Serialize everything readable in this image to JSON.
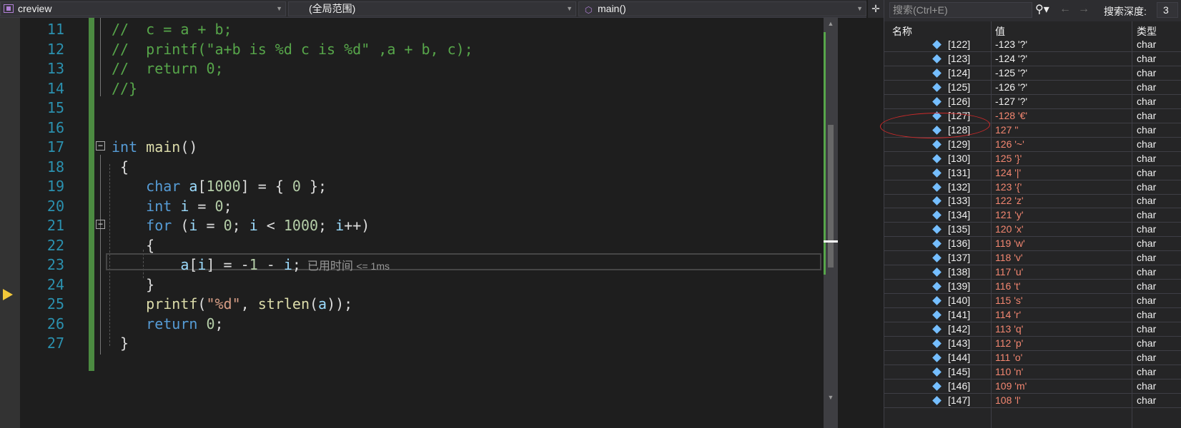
{
  "navbar": {
    "project": "creview",
    "scope": "(全局范围)",
    "function": "main()"
  },
  "editor": {
    "lines": [
      {
        "num": "11",
        "tokens": [
          {
            "c": "cmt",
            "t": "//  c = a + b;"
          }
        ]
      },
      {
        "num": "12",
        "tokens": [
          {
            "c": "cmt",
            "t": "//  printf(\"a+b is %d c is %d\" ,a + b, c);"
          }
        ]
      },
      {
        "num": "13",
        "tokens": [
          {
            "c": "cmt",
            "t": "//  return 0;"
          }
        ]
      },
      {
        "num": "14",
        "tokens": [
          {
            "c": "cmt",
            "t": "//}"
          }
        ]
      },
      {
        "num": "15",
        "tokens": []
      },
      {
        "num": "16",
        "tokens": []
      },
      {
        "num": "17",
        "tokens": [
          {
            "c": "kw",
            "t": "int"
          },
          {
            "c": "",
            "t": " "
          },
          {
            "c": "fn",
            "t": "main"
          },
          {
            "c": "",
            "t": "()"
          }
        ]
      },
      {
        "num": "18",
        "tokens": [
          {
            "c": "",
            "t": " {"
          }
        ]
      },
      {
        "num": "19",
        "tokens": [
          {
            "c": "",
            "t": "    "
          },
          {
            "c": "kw",
            "t": "char"
          },
          {
            "c": "",
            "t": " "
          },
          {
            "c": "id",
            "t": "a"
          },
          {
            "c": "",
            "t": "["
          },
          {
            "c": "num",
            "t": "1000"
          },
          {
            "c": "",
            "t": "] = { "
          },
          {
            "c": "num",
            "t": "0"
          },
          {
            "c": "",
            "t": " };"
          }
        ]
      },
      {
        "num": "20",
        "tokens": [
          {
            "c": "",
            "t": "    "
          },
          {
            "c": "kw",
            "t": "int"
          },
          {
            "c": "",
            "t": " "
          },
          {
            "c": "id",
            "t": "i"
          },
          {
            "c": "",
            "t": " = "
          },
          {
            "c": "num",
            "t": "0"
          },
          {
            "c": "",
            "t": ";"
          }
        ]
      },
      {
        "num": "21",
        "tokens": [
          {
            "c": "",
            "t": "    "
          },
          {
            "c": "kw",
            "t": "for"
          },
          {
            "c": "",
            "t": " ("
          },
          {
            "c": "id",
            "t": "i"
          },
          {
            "c": "",
            "t": " = "
          },
          {
            "c": "num",
            "t": "0"
          },
          {
            "c": "",
            "t": "; "
          },
          {
            "c": "id",
            "t": "i"
          },
          {
            "c": "",
            "t": " < "
          },
          {
            "c": "num",
            "t": "1000"
          },
          {
            "c": "",
            "t": "; "
          },
          {
            "c": "id",
            "t": "i"
          },
          {
            "c": "",
            "t": "++)"
          }
        ]
      },
      {
        "num": "22",
        "tokens": [
          {
            "c": "",
            "t": "    {"
          }
        ]
      },
      {
        "num": "23",
        "tokens": [
          {
            "c": "",
            "t": "        "
          },
          {
            "c": "id",
            "t": "a"
          },
          {
            "c": "",
            "t": "["
          },
          {
            "c": "id",
            "t": "i"
          },
          {
            "c": "",
            "t": "] = -"
          },
          {
            "c": "num",
            "t": "1"
          },
          {
            "c": "",
            "t": " - "
          },
          {
            "c": "id",
            "t": "i"
          },
          {
            "c": "",
            "t": ";"
          }
        ]
      },
      {
        "num": "24",
        "tokens": [
          {
            "c": "",
            "t": "    }"
          }
        ]
      },
      {
        "num": "25",
        "tokens": [
          {
            "c": "",
            "t": "    "
          },
          {
            "c": "fn",
            "t": "printf"
          },
          {
            "c": "",
            "t": "("
          },
          {
            "c": "str",
            "t": "\"%d\""
          },
          {
            "c": "",
            "t": ", "
          },
          {
            "c": "fn",
            "t": "strlen"
          },
          {
            "c": "",
            "t": "("
          },
          {
            "c": "id",
            "t": "a"
          },
          {
            "c": "",
            "t": "));"
          }
        ]
      },
      {
        "num": "26",
        "tokens": [
          {
            "c": "",
            "t": "    "
          },
          {
            "c": "kw",
            "t": "return"
          },
          {
            "c": "",
            "t": " "
          },
          {
            "c": "num",
            "t": "0"
          },
          {
            "c": "",
            "t": ";"
          }
        ]
      },
      {
        "num": "27",
        "tokens": [
          {
            "c": "",
            "t": " }"
          }
        ]
      }
    ],
    "perf_tip": "已用时间",
    "perf_tip_value": "<= 1ms"
  },
  "watch": {
    "search_placeholder": "搜索(Ctrl+E)",
    "depth_label": "搜索深度:",
    "depth_value": "3",
    "col_name": "名称",
    "col_value": "值",
    "col_type": "类型",
    "rows": [
      {
        "name": "[122]",
        "value": "-123 '?'",
        "type": "char",
        "changed": false
      },
      {
        "name": "[123]",
        "value": "-124 '?'",
        "type": "char",
        "changed": false
      },
      {
        "name": "[124]",
        "value": "-125 '?'",
        "type": "char",
        "changed": false
      },
      {
        "name": "[125]",
        "value": "-126 '?'",
        "type": "char",
        "changed": false
      },
      {
        "name": "[126]",
        "value": "-127 '?'",
        "type": "char",
        "changed": false
      },
      {
        "name": "[127]",
        "value": "-128 '€'",
        "type": "char",
        "changed": true
      },
      {
        "name": "[128]",
        "value": "127 ''",
        "type": "char",
        "changed": true
      },
      {
        "name": "[129]",
        "value": "126 '~'",
        "type": "char",
        "changed": true
      },
      {
        "name": "[130]",
        "value": "125 '}'",
        "type": "char",
        "changed": true
      },
      {
        "name": "[131]",
        "value": "124 '|'",
        "type": "char",
        "changed": true
      },
      {
        "name": "[132]",
        "value": "123 '{'",
        "type": "char",
        "changed": true
      },
      {
        "name": "[133]",
        "value": "122 'z'",
        "type": "char",
        "changed": true
      },
      {
        "name": "[134]",
        "value": "121 'y'",
        "type": "char",
        "changed": true
      },
      {
        "name": "[135]",
        "value": "120 'x'",
        "type": "char",
        "changed": true
      },
      {
        "name": "[136]",
        "value": "119 'w'",
        "type": "char",
        "changed": true
      },
      {
        "name": "[137]",
        "value": "118 'v'",
        "type": "char",
        "changed": true
      },
      {
        "name": "[138]",
        "value": "117 'u'",
        "type": "char",
        "changed": true
      },
      {
        "name": "[139]",
        "value": "116 't'",
        "type": "char",
        "changed": true
      },
      {
        "name": "[140]",
        "value": "115 's'",
        "type": "char",
        "changed": true
      },
      {
        "name": "[141]",
        "value": "114 'r'",
        "type": "char",
        "changed": true
      },
      {
        "name": "[142]",
        "value": "113 'q'",
        "type": "char",
        "changed": true
      },
      {
        "name": "[143]",
        "value": "112 'p'",
        "type": "char",
        "changed": true
      },
      {
        "name": "[144]",
        "value": "111 'o'",
        "type": "char",
        "changed": true
      },
      {
        "name": "[145]",
        "value": "110 'n'",
        "type": "char",
        "changed": true
      },
      {
        "name": "[146]",
        "value": "109 'm'",
        "type": "char",
        "changed": true
      },
      {
        "name": "[147]",
        "value": "108 'l'",
        "type": "char",
        "changed": true
      }
    ]
  },
  "colors": {
    "editor_bg": "#1e1e1e",
    "comment": "#57a64a",
    "keyword": "#569cd6",
    "changed_value": "#f48771",
    "highlight_ellipse": "#cc2a2a",
    "exec_arrow": "#f2c83a"
  }
}
